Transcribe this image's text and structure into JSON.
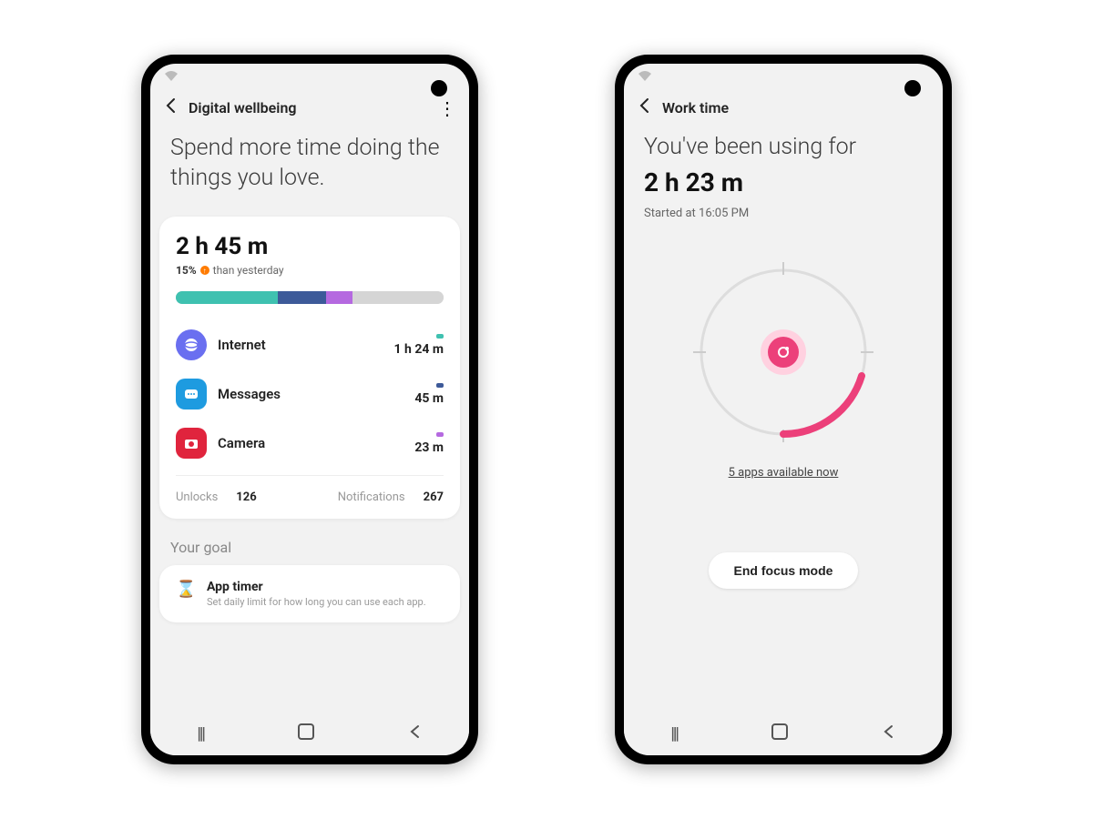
{
  "phone1": {
    "title": "Digital wellbeing",
    "hero": "Spend more time doing the things you love.",
    "total_time": "2 h 45 m",
    "trend_pct": "15%",
    "trend_label": "than yesterday",
    "segments": [
      {
        "color": "#3fc1b0",
        "pct": 38
      },
      {
        "color": "#3d5a99",
        "pct": 18
      },
      {
        "color": "#b569e0",
        "pct": 10
      },
      {
        "color": "#d5d5d5",
        "pct": 34
      }
    ],
    "apps": [
      {
        "name": "Internet",
        "time": "1 h 24 m",
        "icon_bg": "#6a6ff0",
        "dot": "#3fc1b0",
        "shape": "round"
      },
      {
        "name": "Messages",
        "time": "45 m",
        "icon_bg": "#1e9be0",
        "dot": "#3d5a99",
        "shape": "square"
      },
      {
        "name": "Camera",
        "time": "23 m",
        "icon_bg": "#e0243d",
        "dot": "#b569e0",
        "shape": "square"
      }
    ],
    "unlocks_label": "Unlocks",
    "unlocks_value": "126",
    "notifications_label": "Notifications",
    "notifications_value": "267",
    "goal_header": "Your goal",
    "app_timer_title": "App timer",
    "app_timer_desc": "Set daily limit for how long you can use each app."
  },
  "phone2": {
    "title": "Work time",
    "hero": "You've been using for",
    "time": "2 h 23 m",
    "started": "Started at 16:05 PM",
    "available_link": "5 apps available now",
    "end_button": "End focus mode"
  }
}
